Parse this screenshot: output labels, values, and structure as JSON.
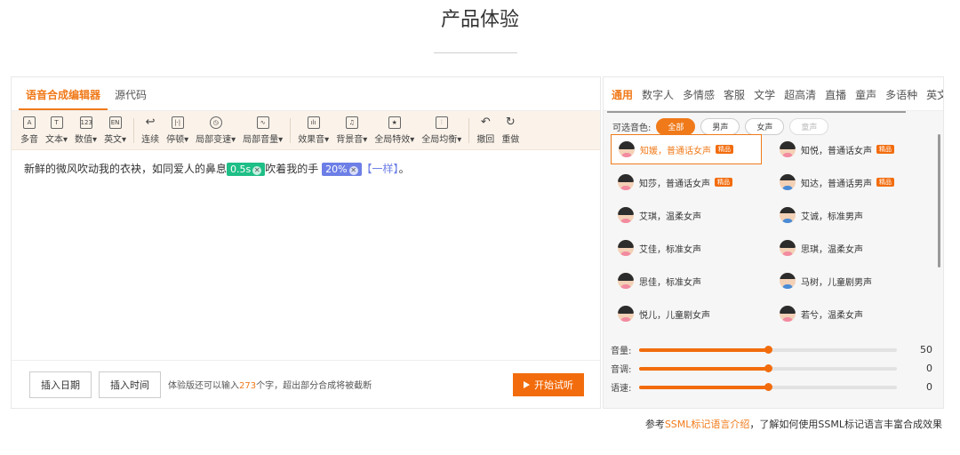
{
  "page": {
    "title": "产品体验"
  },
  "editor": {
    "tabs": [
      {
        "label": "语音合成编辑器",
        "active": true
      },
      {
        "label": "源代码",
        "active": false
      }
    ],
    "toolbar": [
      {
        "icon": "A",
        "label": "多音"
      },
      {
        "icon": "T",
        "label": "文本▾"
      },
      {
        "icon": "123",
        "label": "数值▾"
      },
      {
        "icon": "EN",
        "label": "英文▾"
      },
      {
        "icon": "↩",
        "label": "连续"
      },
      {
        "icon": "|·|",
        "label": "停顿▾"
      },
      {
        "icon": "◷",
        "label": "局部变速▾"
      },
      {
        "icon": "∿",
        "label": "局部音量▾"
      },
      {
        "icon": "ılı",
        "label": "效果音▾"
      },
      {
        "icon": "♫",
        "label": "背景音▾"
      },
      {
        "icon": "★",
        "label": "全局特效▾"
      },
      {
        "icon": "⫶",
        "label": "全局均衡▾"
      },
      {
        "icon": "↶",
        "label": "撤回"
      },
      {
        "icon": "↻",
        "label": "重做"
      }
    ],
    "content": {
      "text_a": "新鲜的微风吹动我的衣袂，如同爱人的鼻息",
      "pause_tag": "0.5s",
      "text_b": "吹着我的手",
      "volume_tag": "20%",
      "bracket_text": "【一样】",
      "text_c": "。"
    },
    "footer": {
      "insert_date": "插入日期",
      "insert_time": "插入时间",
      "note_prefix": "体验版还可以输入",
      "note_count": "273",
      "note_suffix": "个字，超出部分合成将被截断",
      "start_label": "开始试听"
    }
  },
  "voices": {
    "categories": [
      "通用",
      "数字人",
      "多情感",
      "客服",
      "文学",
      "超高清",
      "直播",
      "童声",
      "多语种",
      "英文"
    ],
    "active_category": "通用",
    "filter_label": "可选音色:",
    "filters": [
      {
        "label": "全部",
        "state": "active"
      },
      {
        "label": "男声",
        "state": "normal"
      },
      {
        "label": "女声",
        "state": "normal"
      },
      {
        "label": "童声",
        "state": "disabled"
      }
    ],
    "items": [
      {
        "name": "知媛，普通话女声",
        "gender": "female",
        "badge": "精品",
        "selected": true
      },
      {
        "name": "知悦，普通话女声",
        "gender": "female",
        "badge": "精品",
        "selected": false
      },
      {
        "name": "知莎，普通话女声",
        "gender": "female",
        "badge": "精品",
        "selected": false
      },
      {
        "name": "知达，普通话男声",
        "gender": "male",
        "badge": "精品",
        "selected": false
      },
      {
        "name": "艾琪，温柔女声",
        "gender": "female",
        "badge": "",
        "selected": false
      },
      {
        "name": "艾诚，标准男声",
        "gender": "male",
        "badge": "",
        "selected": false
      },
      {
        "name": "艾佳，标准女声",
        "gender": "female",
        "badge": "",
        "selected": false
      },
      {
        "name": "思琪，温柔女声",
        "gender": "female",
        "badge": "",
        "selected": false
      },
      {
        "name": "思佳，标准女声",
        "gender": "female",
        "badge": "",
        "selected": false
      },
      {
        "name": "马树，儿童剧男声",
        "gender": "male",
        "badge": "",
        "selected": false
      },
      {
        "name": "悦儿，儿童剧女声",
        "gender": "female",
        "badge": "",
        "selected": false
      },
      {
        "name": "若兮，温柔女声",
        "gender": "female",
        "badge": "",
        "selected": false
      }
    ],
    "sliders": [
      {
        "label": "音量:",
        "value": "50",
        "level": 0.5
      },
      {
        "label": "音调:",
        "value": "0",
        "level": 0.5
      },
      {
        "label": "语速:",
        "value": "0",
        "level": 0.5
      }
    ]
  },
  "ssml_note": {
    "prefix": "参考",
    "link": "SSML标记语言介绍",
    "suffix": "，了解如何使用SSML标记语言丰富合成效果"
  },
  "colors": {
    "accent": "#f07a1a",
    "pause_tag": "#1fbf87",
    "volume_tag": "#6d7fe6"
  }
}
